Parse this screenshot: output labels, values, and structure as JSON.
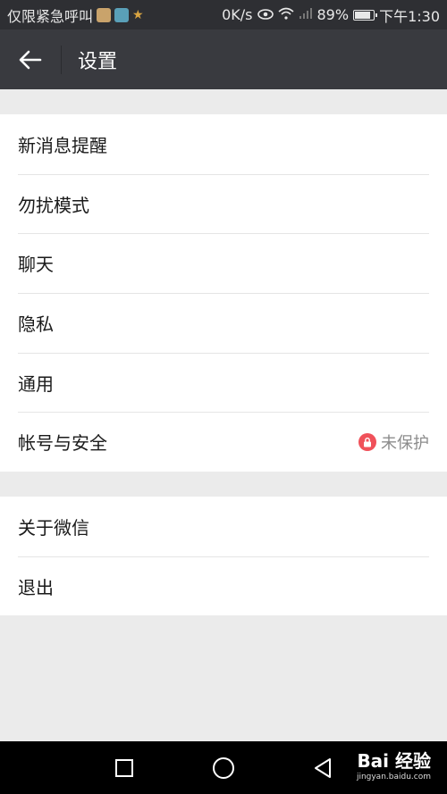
{
  "status_bar": {
    "carrier": "仅限紧急呼叫",
    "speed": "0K/s",
    "battery_text": "89%",
    "battery_level": 0.89,
    "time": "下午1:30"
  },
  "header": {
    "title": "设置"
  },
  "settings_group_1": {
    "items": [
      {
        "label": "新消息提醒"
      },
      {
        "label": "勿扰模式"
      },
      {
        "label": "聊天"
      },
      {
        "label": "隐私"
      },
      {
        "label": "通用"
      },
      {
        "label": "帐号与安全",
        "status": "未保护"
      }
    ]
  },
  "settings_group_2": {
    "items": [
      {
        "label": "关于微信"
      },
      {
        "label": "退出"
      }
    ]
  },
  "watermark": {
    "main": "Bai 经验",
    "sub": "jingyan.baidu.com"
  },
  "colors": {
    "status_bar_bg": "#2e2f33",
    "title_bar_bg": "#393a3f",
    "page_bg": "#ebebeb",
    "lock_badge": "#f0515a"
  }
}
